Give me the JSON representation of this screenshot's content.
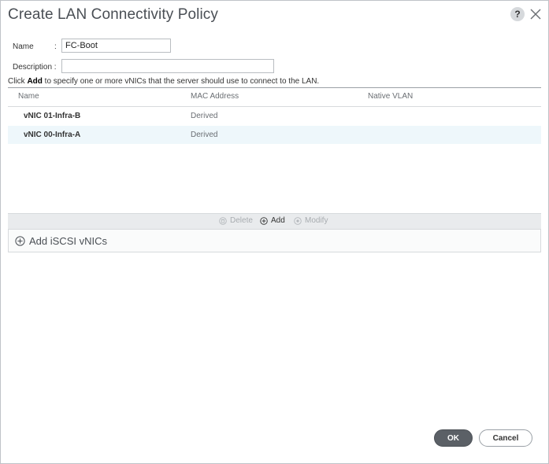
{
  "dialog": {
    "title": "Create LAN Connectivity Policy"
  },
  "icons": {
    "help": "?",
    "close": "close-icon"
  },
  "form": {
    "name_label": "Name",
    "name_colon": ":",
    "name_value": "FC-Boot",
    "description_label": "Description :",
    "description_value": ""
  },
  "hint": {
    "prefix": "Click ",
    "bold": "Add",
    "suffix": " to specify one or more vNICs that the server should use to connect to the LAN."
  },
  "table": {
    "columns": [
      "Name",
      "MAC Address",
      "Native VLAN"
    ],
    "rows": [
      {
        "name": "vNIC 01-Infra-B",
        "mac": "Derived",
        "vlan": ""
      },
      {
        "name": "vNIC 00-Infra-A",
        "mac": "Derived",
        "vlan": ""
      }
    ]
  },
  "toolbar": {
    "delete_label": "Delete",
    "add_label": "Add",
    "modify_label": "Modify"
  },
  "iscsi": {
    "label": "Add iSCSI vNICs"
  },
  "footer": {
    "ok_label": "OK",
    "cancel_label": "Cancel"
  },
  "colors": {
    "primary_button": "#5b6066",
    "selected_row": "#eef7fb",
    "toolbar_bg": "#e9ebed"
  }
}
